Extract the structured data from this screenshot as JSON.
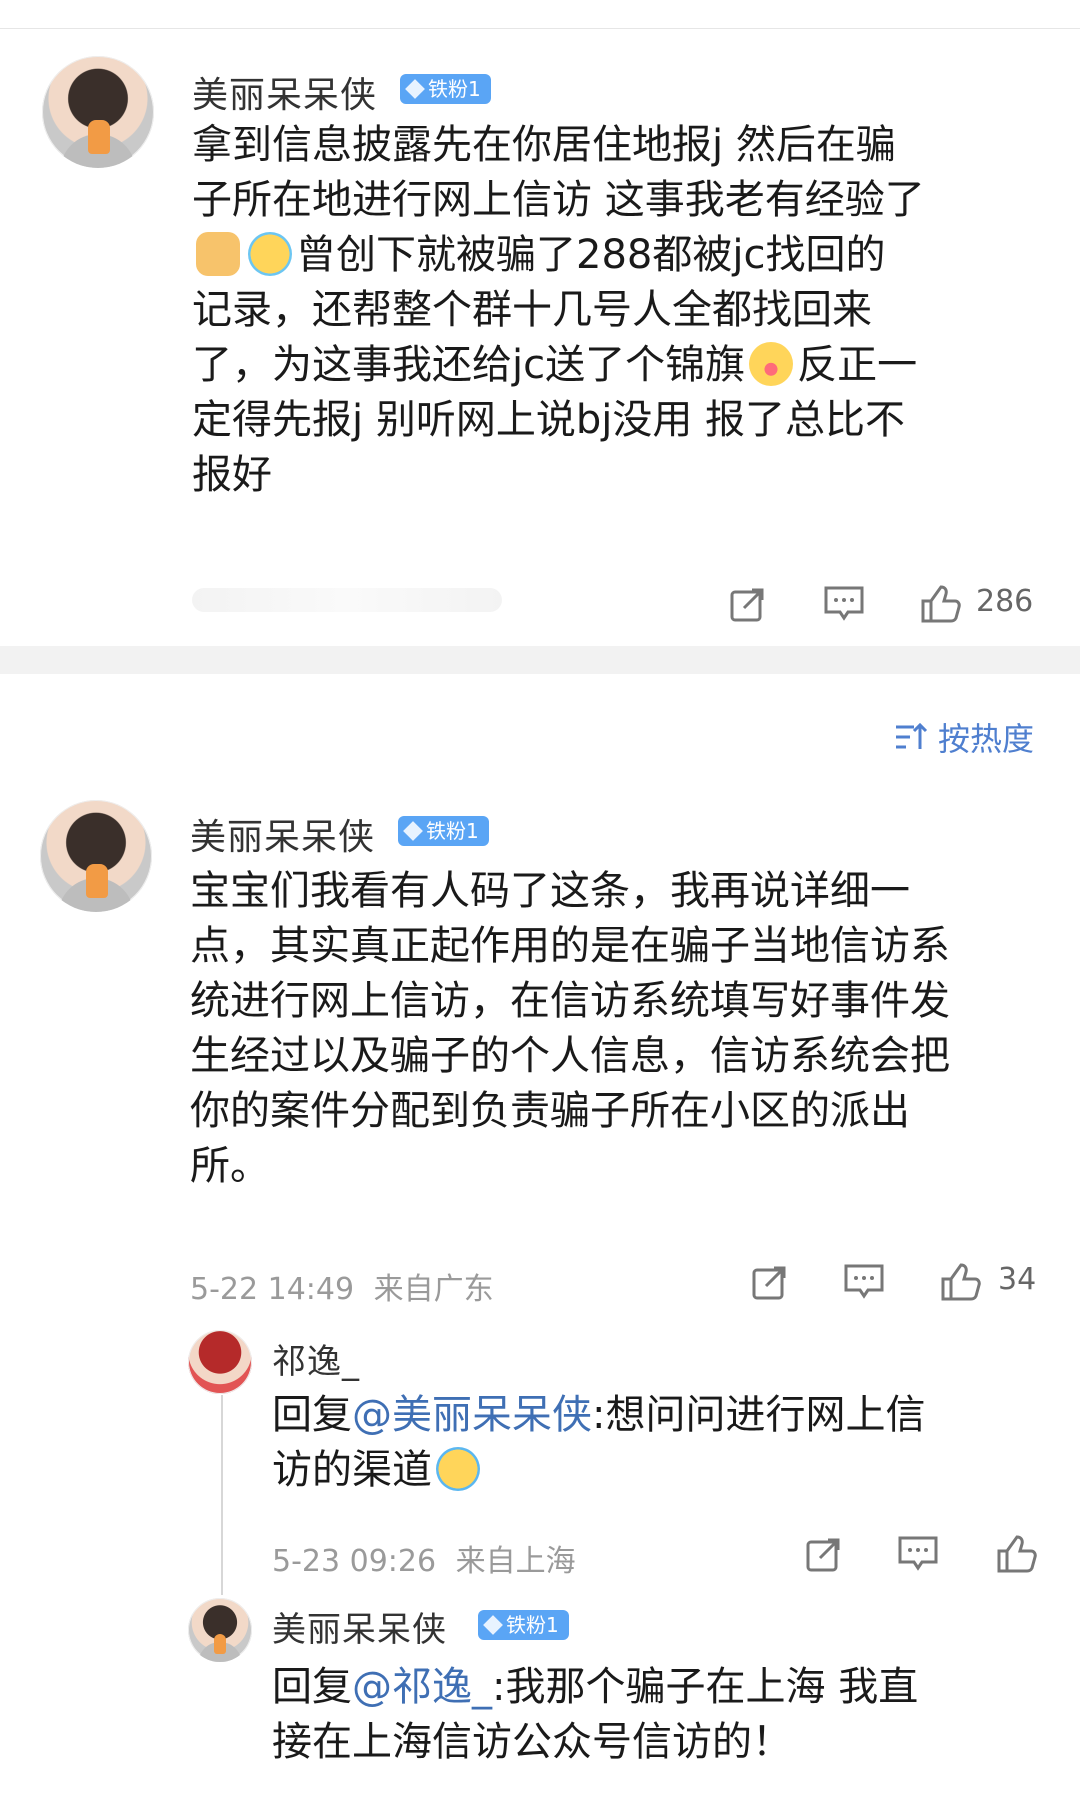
{
  "sort": {
    "label": "按热度"
  },
  "comments": [
    {
      "username": "美丽呆呆侠",
      "badge": "铁粉1",
      "text_lines": [
        "拿到信息披露先在你居住地报j 然后在骗",
        "子所在地进行网上信访 这事我老有经验了",
        "曾创下就被骗了288都被jc找回的",
        "记录，还帮整个群十几号人全都找回来",
        "了，为这事我还给jc送了个锦旗",
        "反正一",
        "定得先报j 别听网上说bj没用 报了总比不",
        "报好"
      ],
      "likes": "286",
      "emoji_names": [
        "thumbs-up-emoji",
        "laugh-cry-emoji",
        "tongue-emoji"
      ]
    },
    {
      "username": "美丽呆呆侠",
      "badge": "铁粉1",
      "text_lines": [
        "宝宝们我看有人码了这条，我再说详细一",
        "点，其实真正起作用的是在骗子当地信访系",
        "统进行网上信访，在信访系统填写好事件发",
        "生经过以及骗子的个人信息，信访系统会把",
        "你的案件分配到负责骗子所在小区的派出",
        "所。"
      ],
      "time": "5-22 14:49",
      "location": "来自广东",
      "likes": "34",
      "replies": [
        {
          "username": "祁逸_",
          "prefix": "回复",
          "mention": "@美丽呆呆侠",
          "text_line1": ":想问问进行网上信",
          "text_line2": "访的渠道",
          "time": "5-23 09:26",
          "location": "来自上海"
        },
        {
          "username": "美丽呆呆侠",
          "badge": "铁粉1",
          "prefix": "回复",
          "mention": "@祁逸_",
          "text_line1": ":我那个骗子在上海 我直",
          "text_line2": "接在上海信访公众号信访的！"
        }
      ]
    }
  ]
}
